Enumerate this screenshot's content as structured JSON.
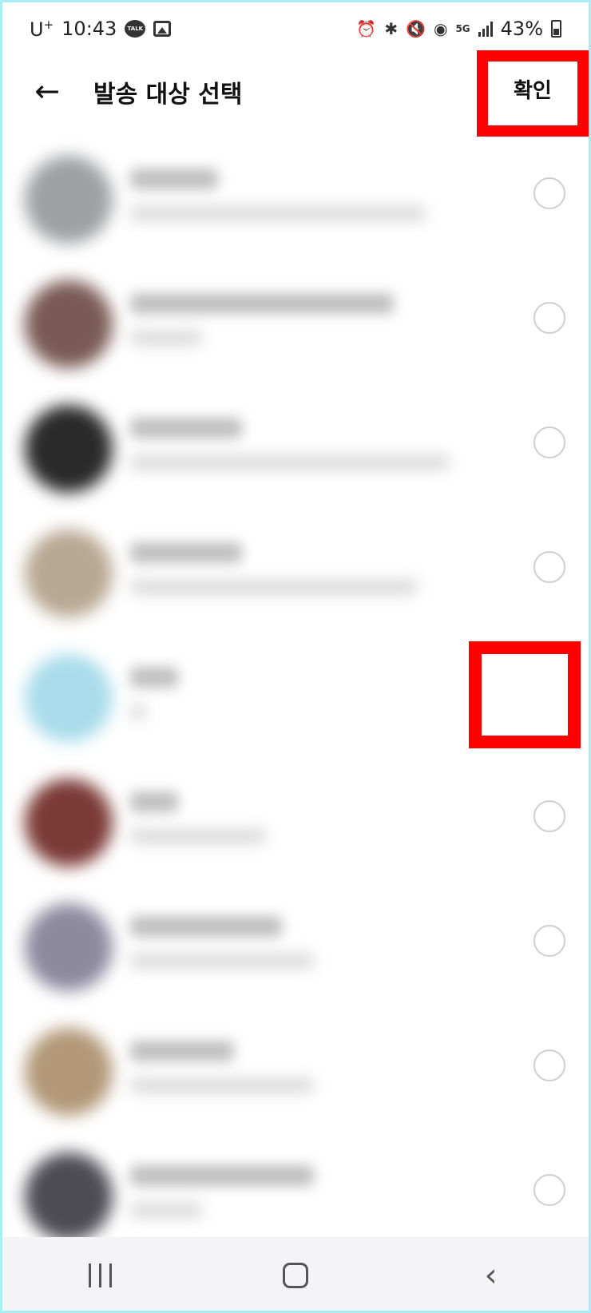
{
  "status_bar": {
    "carrier": "U",
    "carrier_sup": "+",
    "time": "10:43",
    "talk_badge": "TALK",
    "network": "5G",
    "battery": "43%",
    "icons": [
      "kakaotalk-icon",
      "gallery-icon",
      "alarm-icon",
      "bluetooth-icon",
      "mute-icon",
      "hotspot-icon",
      "5g-icon",
      "signal-icon",
      "battery-icon"
    ]
  },
  "header": {
    "back_icon": "←",
    "title": "발송 대상 선택",
    "confirm_label": "확인"
  },
  "contacts": [
    {
      "avatar_color": "#9ea0a3",
      "selected": false
    },
    {
      "avatar_color": "#7a5a55",
      "selected": false
    },
    {
      "avatar_color": "#2a2a2a",
      "selected": false
    },
    {
      "avatar_color": "#b8a893",
      "selected": false
    },
    {
      "avatar_color": "#a9dceb",
      "selected": true
    },
    {
      "avatar_color": "#7a3a36",
      "selected": false
    },
    {
      "avatar_color": "#8e8a9e",
      "selected": false
    },
    {
      "avatar_color": "#b29878",
      "selected": false
    },
    {
      "avatar_color": "#4d4c55",
      "selected": false
    }
  ],
  "highlight_color": "#ff0000",
  "accent_color": "#ffe500",
  "nav": {
    "recent_icon": "recent-apps-icon",
    "home_icon": "home-icon",
    "back_icon": "‹"
  }
}
